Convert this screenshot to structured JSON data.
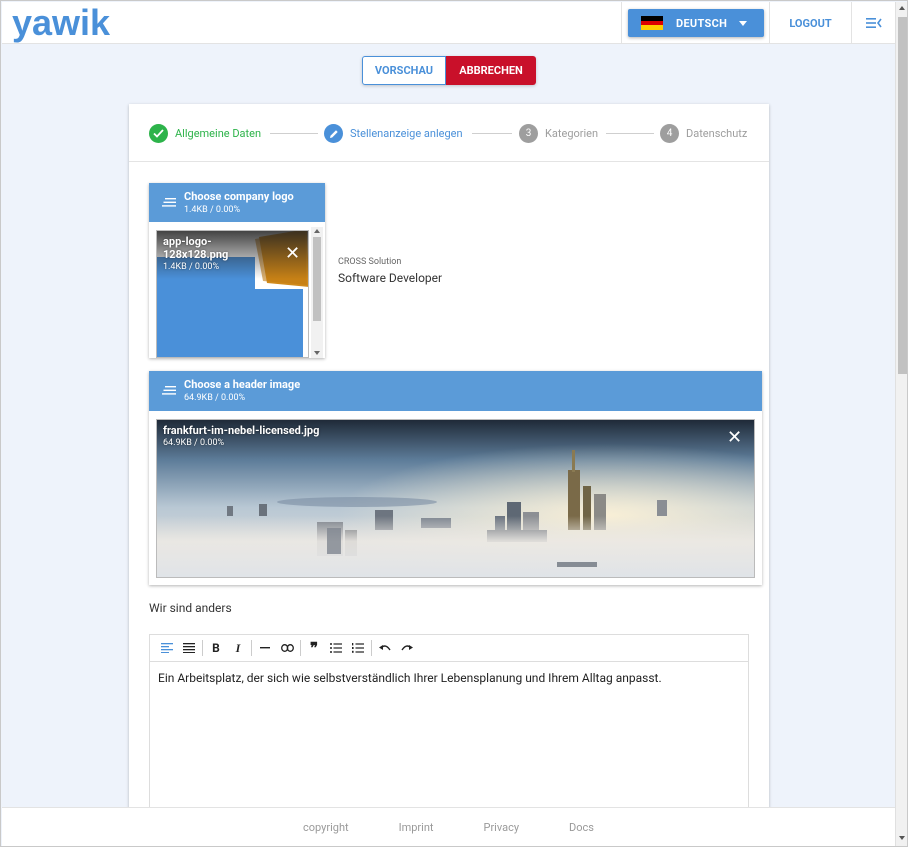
{
  "brand": {
    "logo_text": "yawik"
  },
  "header": {
    "language": {
      "label": "DEUTSCH",
      "flag": "de-flag-icon"
    },
    "logout_label": "LOGOUT",
    "menu_icon": "menu-collapse-icon"
  },
  "actions": {
    "preview_label": "VORSCHAU",
    "cancel_label": "ABBRECHEN"
  },
  "stepper": {
    "steps": [
      {
        "number": "1",
        "label": "Allgemeine Daten",
        "state": "done"
      },
      {
        "number": "2",
        "label": "Stellenanzeige anlegen",
        "state": "active"
      },
      {
        "number": "3",
        "label": "Kategorien",
        "state": "pending"
      },
      {
        "number": "4",
        "label": "Datenschutz",
        "state": "pending"
      }
    ]
  },
  "logo_upload": {
    "title": "Choose company logo",
    "subtitle": "1.4KB / 0.00%",
    "file": {
      "name": "app-logo-128x128.png",
      "size": "1.4KB / 0.00%"
    }
  },
  "company": {
    "name": "CROSS Solution",
    "job_title": "Software Developer"
  },
  "header_upload": {
    "title": "Choose a header image",
    "subtitle": "64.9KB / 0.00%",
    "file": {
      "name": "frankfurt-im-nebel-licensed.jpg",
      "size": "64.9KB / 0.00%"
    }
  },
  "intro": {
    "label": "Wir sind anders"
  },
  "editor": {
    "content": "Ein Arbeitsplatz, der sich wie selbstverständlich Ihrer Lebensplanung und Ihrem Alltag anpasst.",
    "toolbar": [
      "align-left-icon",
      "justify-icon",
      "bold-icon",
      "italic-icon",
      "horizontal-rule-icon",
      "link-icon",
      "blockquote-icon",
      "bullet-list-icon",
      "ordered-list-icon",
      "undo-icon",
      "redo-icon"
    ]
  },
  "footer": {
    "links": [
      "copyright",
      "Imprint",
      "Privacy",
      "Docs"
    ]
  },
  "colors": {
    "primary": "#4a90d9",
    "danger": "#c9102a",
    "success": "#2db34a",
    "muted": "#9e9e9e"
  }
}
